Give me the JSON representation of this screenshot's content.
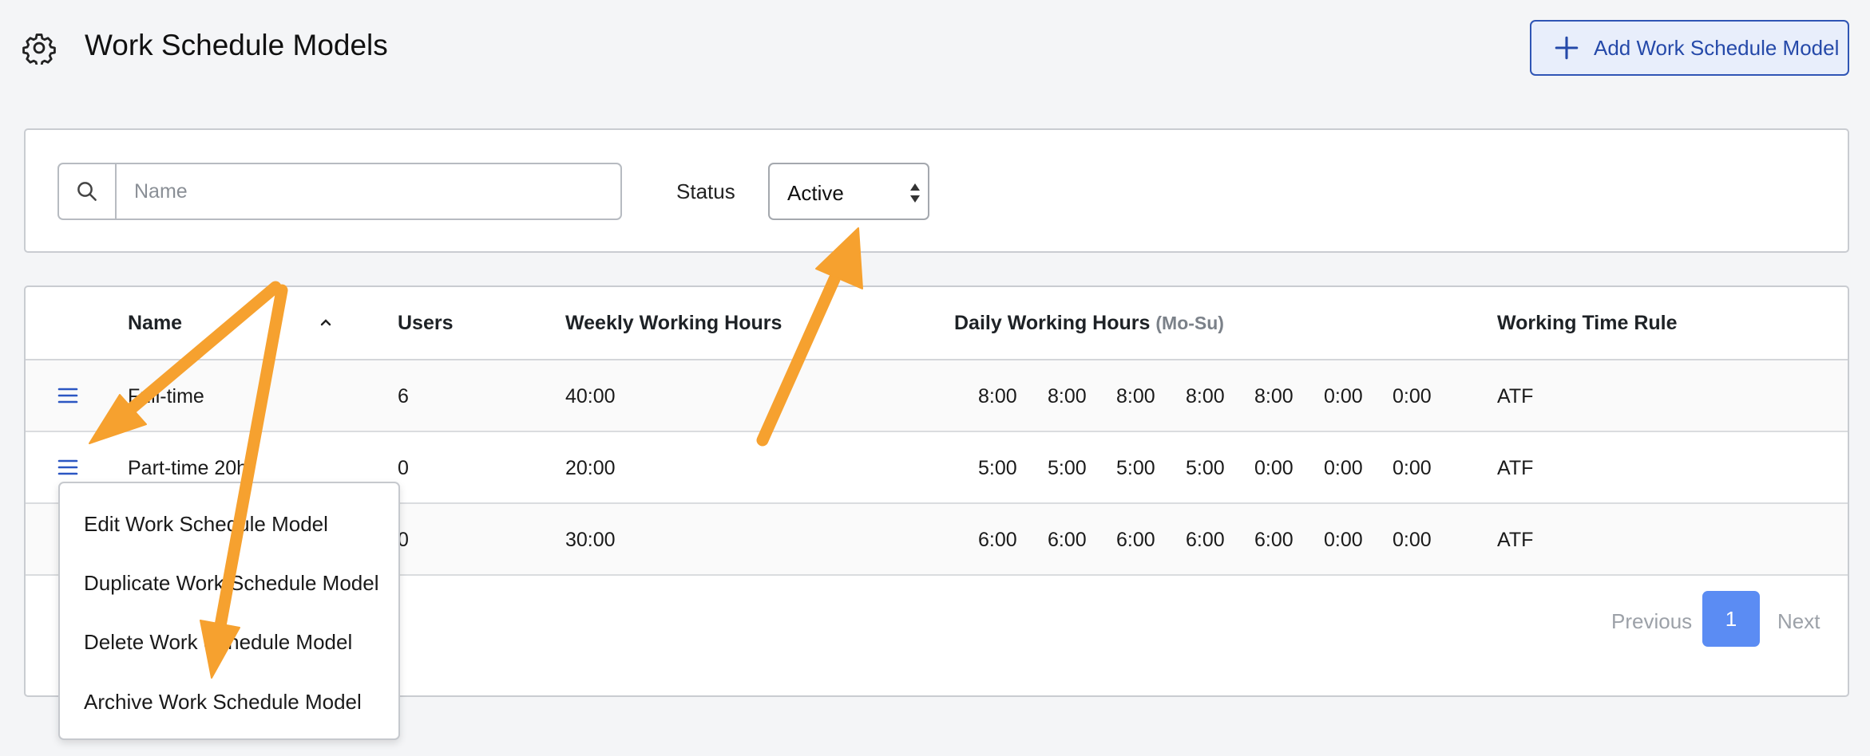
{
  "header": {
    "title": "Work Schedule Models",
    "settings_icon": "gear-icon",
    "add_button_label": "Add Work Schedule Model",
    "add_button_icon": "plus-icon",
    "accent_color": "#2549a9"
  },
  "filters": {
    "search_placeholder": "Name",
    "search_value": "",
    "status_label": "Status",
    "status_value": "Active"
  },
  "table": {
    "columns": {
      "name": "Name",
      "users": "Users",
      "weekly": "Weekly Working Hours",
      "daily": "Daily Working Hours",
      "daily_hint": "(Mo-Su)",
      "rule": "Working Time Rule"
    },
    "rows": [
      {
        "name": "Full-time",
        "users": "6",
        "weekly": "40:00",
        "daily": [
          "8:00",
          "8:00",
          "8:00",
          "8:00",
          "8:00",
          "0:00",
          "0:00"
        ],
        "rule": "ATF"
      },
      {
        "name": "Part-time 20h",
        "users": "0",
        "weekly": "20:00",
        "daily": [
          "5:00",
          "5:00",
          "5:00",
          "5:00",
          "0:00",
          "0:00",
          "0:00"
        ],
        "rule": "ATF"
      },
      {
        "name": "",
        "users": "0",
        "weekly": "30:00",
        "daily": [
          "6:00",
          "6:00",
          "6:00",
          "6:00",
          "6:00",
          "0:00",
          "0:00"
        ],
        "rule": "ATF"
      }
    ]
  },
  "pagination": {
    "previous": "Previous",
    "current": "1",
    "next": "Next",
    "active_color": "#5b8cf3"
  },
  "row_menu": {
    "items": [
      "Edit Work Schedule Model",
      "Duplicate Work Schedule Model",
      "Delete Work Schedule Model",
      "Archive Work Schedule Model"
    ]
  },
  "annotations": {
    "arrow_color": "#f6a12f"
  }
}
